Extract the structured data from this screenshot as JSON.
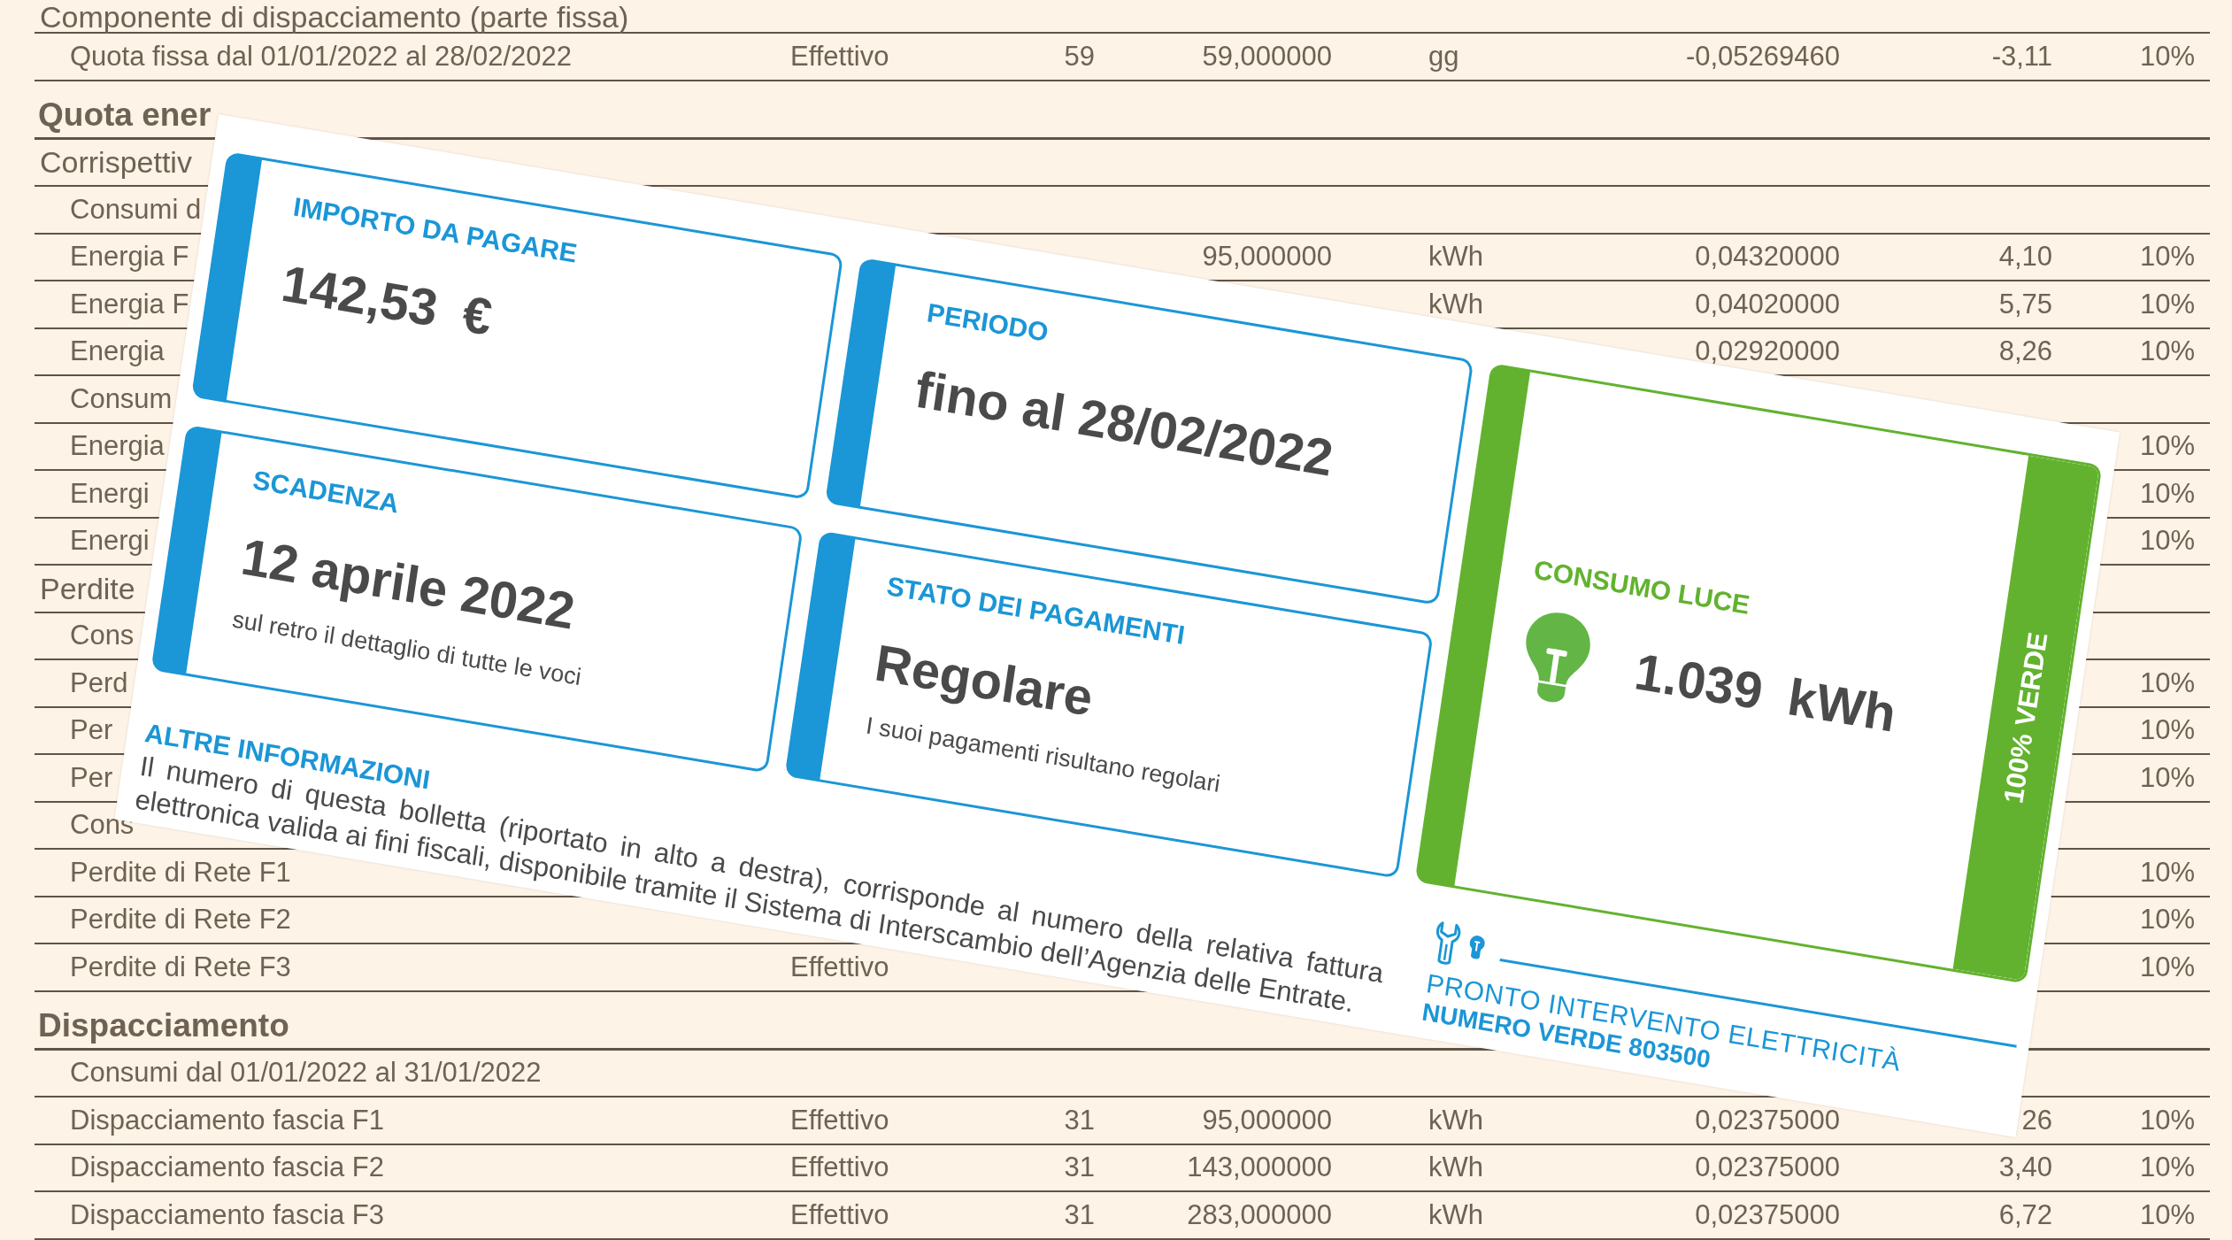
{
  "table": {
    "rows": [
      {
        "kind": "subheading",
        "column_1": "Componente di dispacciamento (parte fissa)"
      },
      {
        "kind": "item",
        "column_1": "Quota fissa dal 01/01/2022 al 28/02/2022",
        "column_2": "Effettivo",
        "column_3": "59",
        "column_4": "59,000000",
        "column_5": "gg",
        "column_6": "-0,05269460",
        "column_7": "-3,11",
        "column_8": "10%"
      },
      {
        "kind": "heading",
        "column_1": "Quota ener"
      },
      {
        "kind": "subheading",
        "column_1": "Corrispettiv"
      },
      {
        "kind": "item",
        "column_1": "Consumi d"
      },
      {
        "kind": "item",
        "column_1": "Energia F",
        "column_4": "95,000000",
        "column_5": "kWh",
        "column_6": "0,04320000",
        "column_7": "4,10",
        "column_8": "10%"
      },
      {
        "kind": "item",
        "column_1": "Energia F",
        "column_5": "kWh",
        "column_6": "0,04020000",
        "column_7": "5,75",
        "column_8": "10%"
      },
      {
        "kind": "item",
        "column_1": "Energia",
        "column_6": "0,02920000",
        "column_7": "8,26",
        "column_8": "10%"
      },
      {
        "kind": "item",
        "column_1": "Consum"
      },
      {
        "kind": "item",
        "column_1": "Energia",
        "column_8": "10%"
      },
      {
        "kind": "item",
        "column_1": "Energi",
        "column_8": "10%"
      },
      {
        "kind": "item",
        "column_1": "Energi",
        "column_8": "10%"
      },
      {
        "kind": "subheading",
        "column_1": "Perdite"
      },
      {
        "kind": "item",
        "column_1": "Cons"
      },
      {
        "kind": "item",
        "column_1": "Perd",
        "column_8": "10%"
      },
      {
        "kind": "item",
        "column_1": "Per",
        "column_8": "10%"
      },
      {
        "kind": "item",
        "column_1": "Per",
        "column_8": "10%"
      },
      {
        "kind": "item",
        "column_1": "Cons"
      },
      {
        "kind": "item",
        "column_1": "Perdite di Rete F1",
        "column_8": "10%"
      },
      {
        "kind": "item",
        "column_1": "Perdite di Rete F2",
        "column_8": "10%"
      },
      {
        "kind": "item",
        "column_1": "Perdite di Rete F3",
        "column_2": "Effettivo",
        "column_8": "10%"
      },
      {
        "kind": "heading",
        "column_1": "Dispacciamento"
      },
      {
        "kind": "item",
        "column_1": "Consumi dal 01/01/2022 al 31/01/2022"
      },
      {
        "kind": "item",
        "column_1": "Dispacciamento fascia F1",
        "column_2": "Effettivo",
        "column_3": "31",
        "column_4": "95,000000",
        "column_5": "kWh",
        "column_6": "0,02375000",
        "column_7": "26",
        "column_8": "10%"
      },
      {
        "kind": "item",
        "column_1": "Dispacciamento fascia F2",
        "column_2": "Effettivo",
        "column_3": "31",
        "column_4": "143,000000",
        "column_5": "kWh",
        "column_6": "0,02375000",
        "column_7": "3,40",
        "column_8": "10%"
      },
      {
        "kind": "item",
        "column_1": "Dispacciamento fascia F3",
        "column_2": "Effettivo",
        "column_3": "31",
        "column_4": "283,000000",
        "column_5": "kWh",
        "column_6": "0,02375000",
        "column_7": "6,72",
        "column_8": "10%"
      }
    ]
  },
  "summary": {
    "panels": [
      {
        "title": "IMPORTO DA PAGARE",
        "value": "142,53",
        "unit": "€"
      },
      {
        "title": "PERIODO",
        "value": "fino al 28/02/2022"
      },
      {
        "title": "SCADENZA",
        "value": "12 aprile 2022",
        "note": "sul retro il dettaglio di tutte le voci"
      },
      {
        "title": "STATO DEI PAGAMENTI",
        "value": "Regolare",
        "note": "I suoi pagamenti risultano regolari"
      }
    ],
    "consumption": {
      "title": "CONSUMO LUCE",
      "value": "1.039",
      "unit": "kWh",
      "band": "100% VERDE"
    },
    "other_info": {
      "title": "ALTRE INFORMAZIONI",
      "text": "Il numero di questa bolletta (riportato in alto a destra), corrisponde al numero della relativa fattura elettronica valida ai fini fiscali, disponibile tramite il Sistema di Interscambio dell’Agenzia delle Entrate."
    },
    "hotline": {
      "title": "PRONTO INTERVENTO ELETTRICITÀ",
      "number": "NUMERO VERDE 803500"
    }
  }
}
